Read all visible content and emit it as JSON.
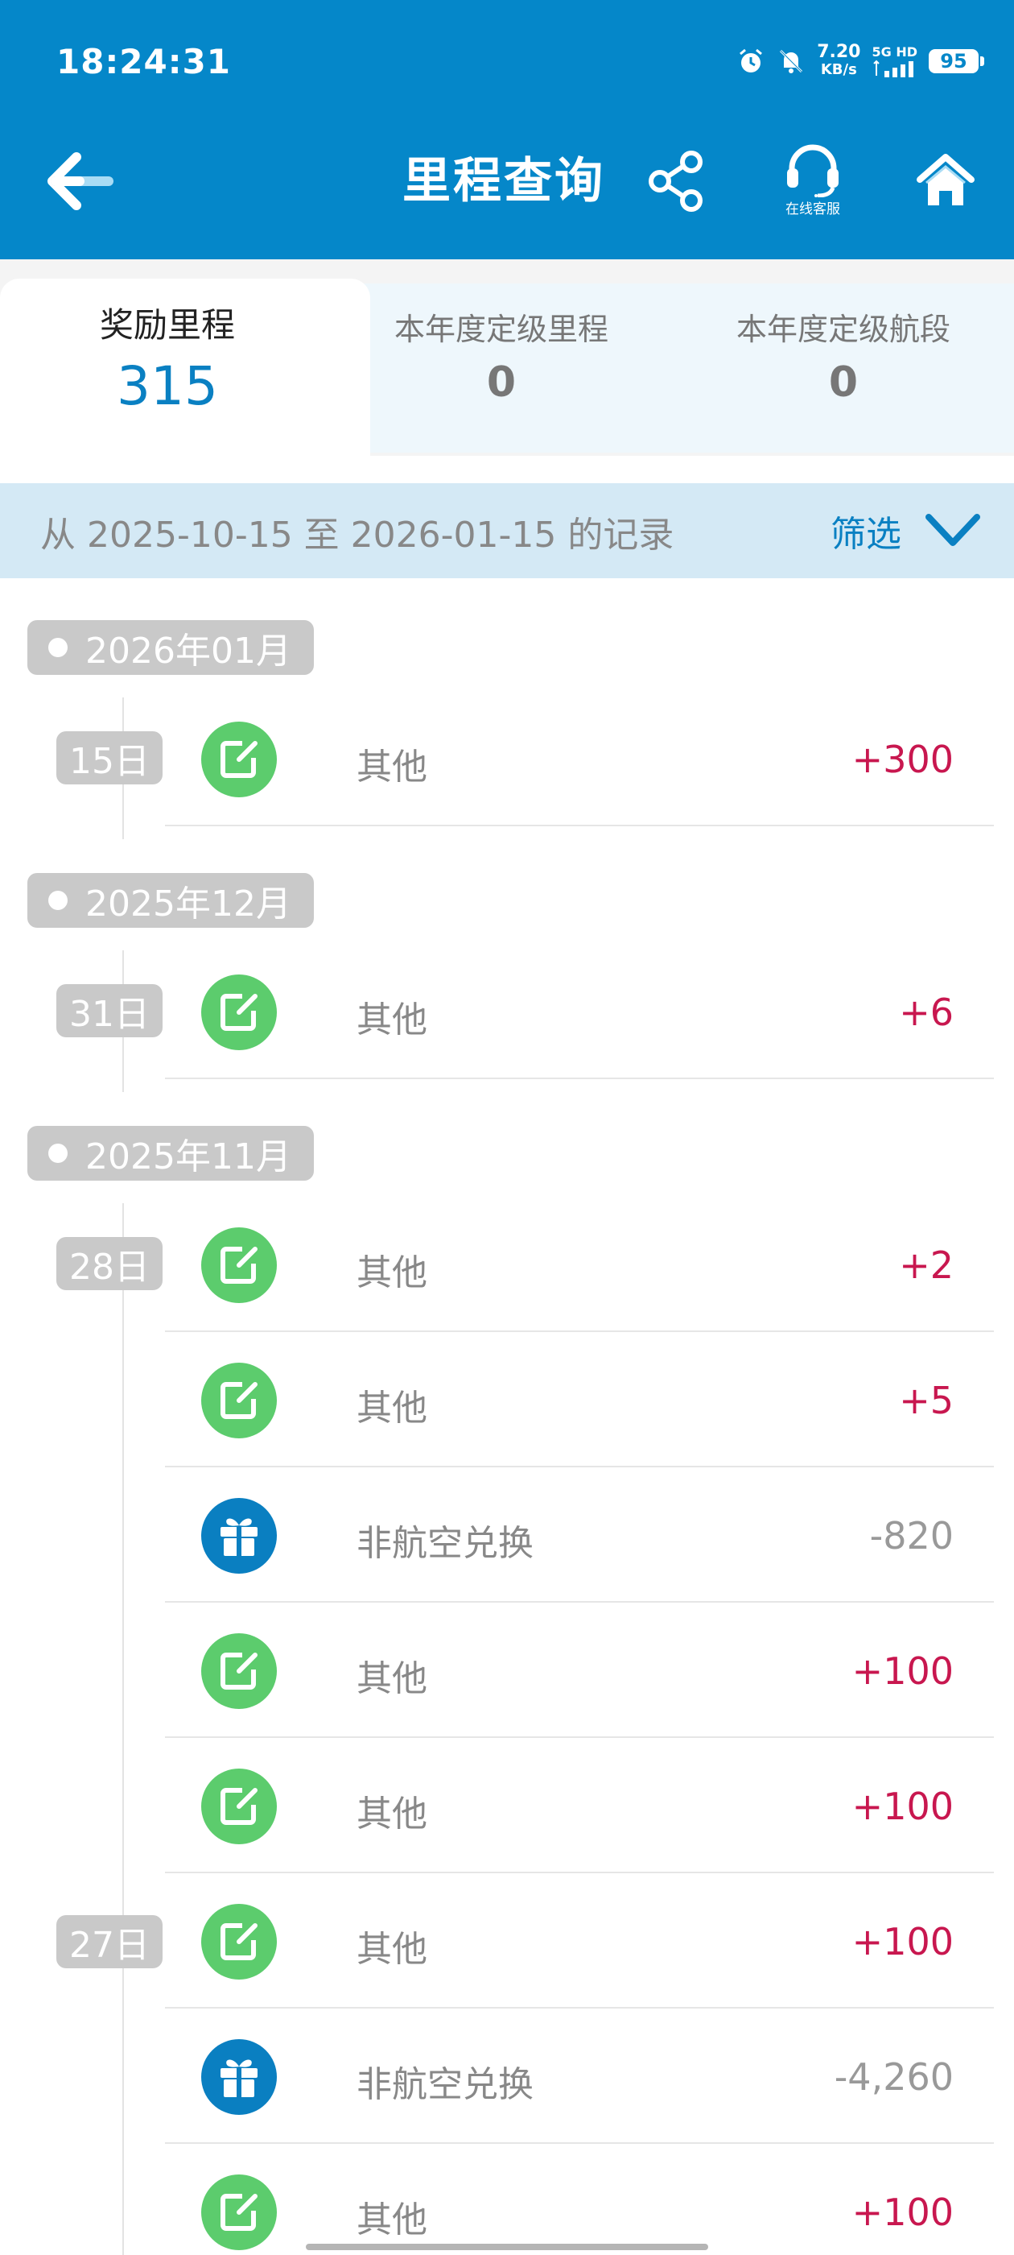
{
  "status_bar": {
    "time": "18:24:31",
    "net_speed_value": "7.20",
    "net_speed_unit": "KB/s",
    "signal_label": "5G HD",
    "battery": "95"
  },
  "header": {
    "title": "里程查询",
    "support_label": "在线客服",
    "icons": [
      "back-arrow-icon",
      "share-icon",
      "headset-icon",
      "home-icon"
    ]
  },
  "summary": {
    "tabs": [
      {
        "label": "奖励里程",
        "value": "315",
        "active": true
      },
      {
        "label": "本年度定级里程",
        "value": "0",
        "active": false
      },
      {
        "label": "本年度定级航段",
        "value": "0",
        "active": false
      }
    ]
  },
  "filter": {
    "range_text": "从 2025-10-15 至 2026-01-15 的记录",
    "button_label": "筛选"
  },
  "months": [
    {
      "label": "2026年01月"
    },
    {
      "label": "2025年12月"
    },
    {
      "label": "2025年11月"
    }
  ],
  "days": [
    {
      "label": "15日"
    },
    {
      "label": "31日"
    },
    {
      "label": "28日"
    },
    {
      "label": "27日"
    }
  ],
  "records": [
    {
      "label": "其他",
      "amount": "+300",
      "icon": "edit-icon"
    },
    {
      "label": "其他",
      "amount": "+6",
      "icon": "edit-icon"
    },
    {
      "label": "其他",
      "amount": "+2",
      "icon": "edit-icon"
    },
    {
      "label": "其他",
      "amount": "+5",
      "icon": "edit-icon"
    },
    {
      "label": "非航空兑换",
      "amount": "-820",
      "icon": "gift-icon"
    },
    {
      "label": "其他",
      "amount": "+100",
      "icon": "edit-icon"
    },
    {
      "label": "其他",
      "amount": "+100",
      "icon": "edit-icon"
    },
    {
      "label": "其他",
      "amount": "+100",
      "icon": "edit-icon"
    },
    {
      "label": "非航空兑换",
      "amount": "-4,260",
      "icon": "gift-icon"
    },
    {
      "label": "其他",
      "amount": "+100",
      "icon": "edit-icon"
    }
  ],
  "colors": {
    "header_blue": "#0587c9",
    "accent_blue": "#0a80c2",
    "positive_red": "#c8174f",
    "negative_gray": "#999999",
    "edit_green": "#5ccc6d",
    "gift_blue": "#0a7fc1",
    "filter_bg": "#d4e9f5"
  }
}
